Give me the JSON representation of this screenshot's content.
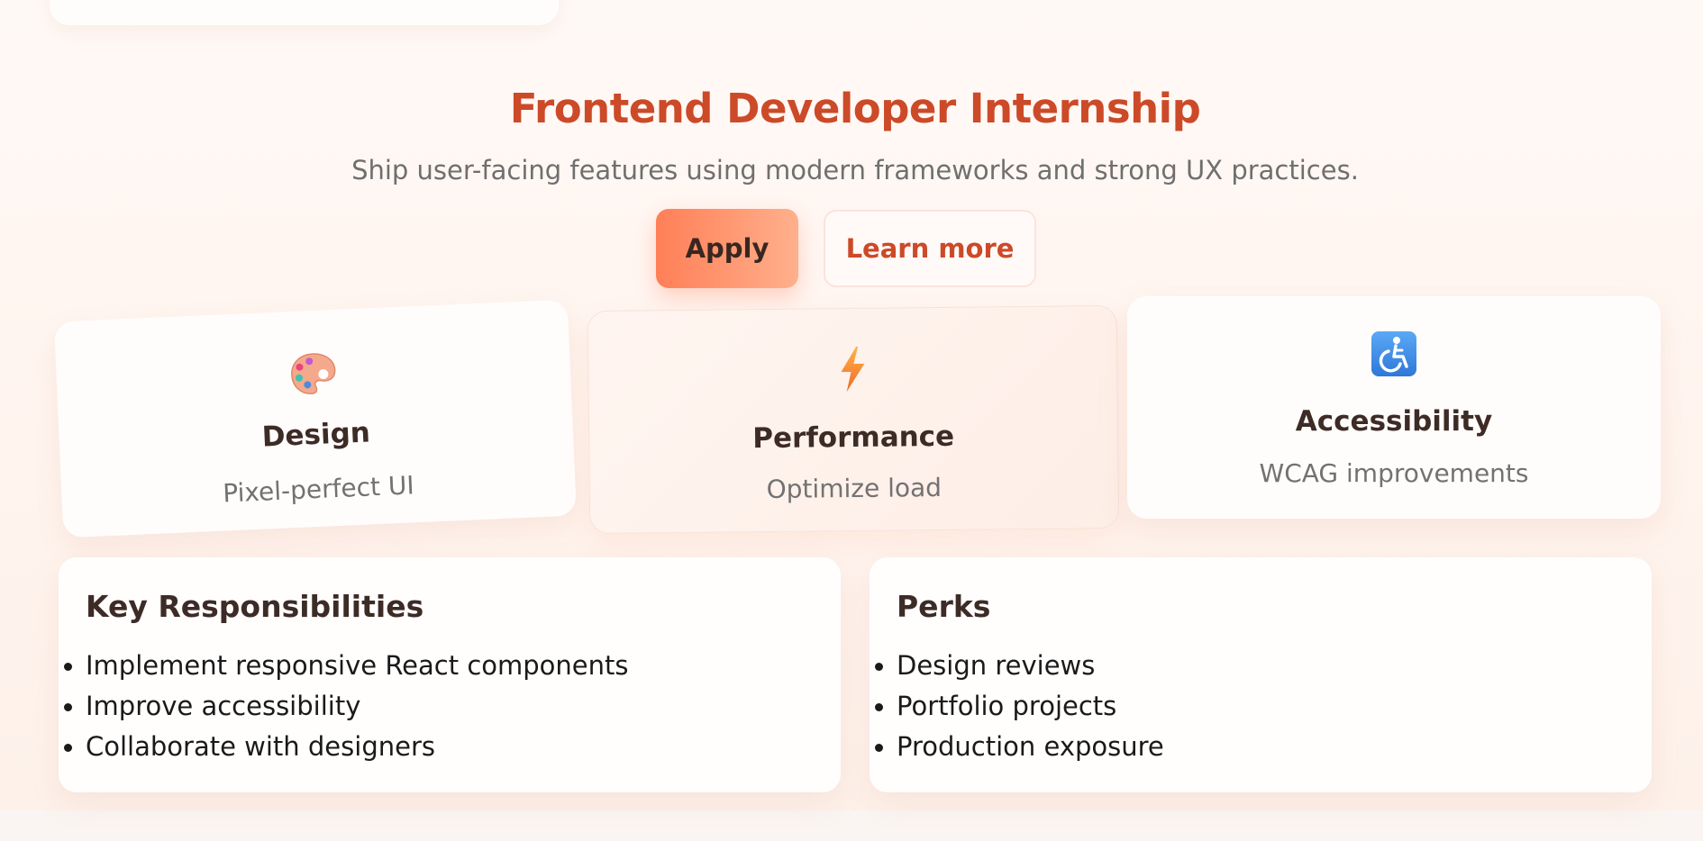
{
  "hero": {
    "title": "Frontend Developer Internship",
    "subtitle": "Ship user-facing features using modern frameworks and strong UX practices.",
    "apply_label": "Apply",
    "learn_more_label": "Learn more"
  },
  "features": [
    {
      "icon": "palette-icon",
      "title": "Design",
      "description": "Pixel-perfect UI"
    },
    {
      "icon": "lightning-bolt-icon",
      "title": "Performance",
      "description": "Optimize load"
    },
    {
      "icon": "wheelchair-accessibility-icon",
      "title": "Accessibility",
      "description": "WCAG improvements"
    }
  ],
  "responsibilities": {
    "heading": "Key Responsibilities",
    "items": [
      "Implement responsive React components",
      "Improve accessibility",
      "Collaborate with designers"
    ]
  },
  "perks": {
    "heading": "Perks",
    "items": [
      "Design reviews",
      "Portfolio projects",
      "Production exposure"
    ]
  },
  "colors": {
    "accent": "#cc4a28",
    "button_gradient_start": "#ff7f57",
    "button_gradient_end": "#ffb08c",
    "heading_text": "#3d2b26",
    "muted_text": "#6f6f6f",
    "background": "#fff7f2"
  }
}
